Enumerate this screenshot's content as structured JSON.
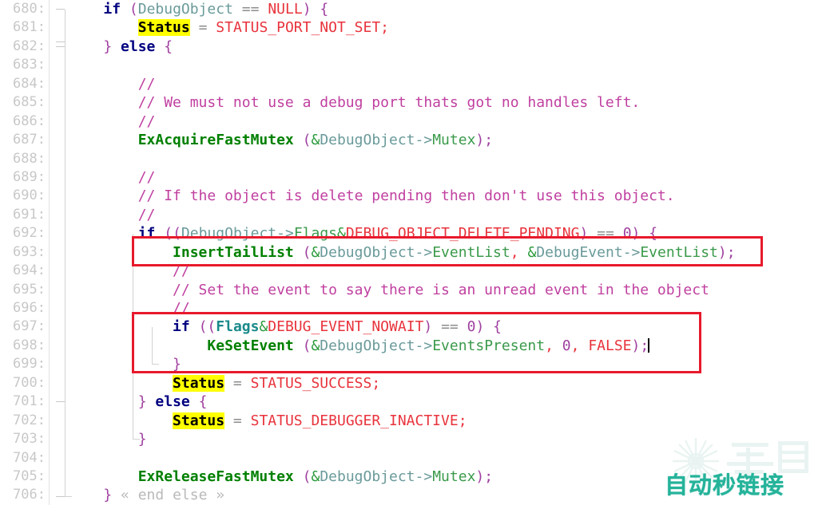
{
  "editor": {
    "language": "c",
    "gutter_separator_color": "#e3e3e3",
    "background": "#ffffff",
    "search_highlight_color": "#ffff00",
    "annotation_color": "#e8192c",
    "first_line_number": 680,
    "last_line_number": 706
  },
  "line_numbers": [
    "680:",
    "681:",
    "682:",
    "683:",
    "684:",
    "685:",
    "686:",
    "687:",
    "688:",
    "689:",
    "690:",
    "691:",
    "692:",
    "693:",
    "694:",
    "695:",
    "696:",
    "697:",
    "698:",
    "699:",
    "700:",
    "701:",
    "702:",
    "703:",
    "704:",
    "705:",
    "706:"
  ],
  "lines": {
    "l680": {
      "n": "680",
      "text": "    if (DebugObject == NULL) {"
    },
    "l681": {
      "n": "681",
      "text": "        Status = STATUS_PORT_NOT_SET;"
    },
    "l682": {
      "n": "682",
      "text": "    } else {"
    },
    "l683": {
      "n": "683",
      "text": ""
    },
    "l684": {
      "n": "684",
      "text": "        //"
    },
    "l685": {
      "n": "685",
      "text": "        // We must not use a debug port thats got no handles left."
    },
    "l686": {
      "n": "686",
      "text": "        //"
    },
    "l687": {
      "n": "687",
      "text": "        ExAcquireFastMutex (&DebugObject->Mutex);"
    },
    "l688": {
      "n": "688",
      "text": ""
    },
    "l689": {
      "n": "689",
      "text": "        //"
    },
    "l690": {
      "n": "690",
      "text": "        // If the object is delete pending then don't use this object."
    },
    "l691": {
      "n": "691",
      "text": "        //"
    },
    "l692": {
      "n": "692",
      "text": "        if ((DebugObject->Flags&DEBUG_OBJECT_DELETE_PENDING) == 0) {"
    },
    "l693": {
      "n": "693",
      "text": "            InsertTailList (&DebugObject->EventList, &DebugEvent->EventList);"
    },
    "l694": {
      "n": "694",
      "text": "            //"
    },
    "l695": {
      "n": "695",
      "text": "            // Set the event to say there is an unread event in the object"
    },
    "l696": {
      "n": "696",
      "text": "            //"
    },
    "l697": {
      "n": "697",
      "text": "            if ((Flags&DEBUG_EVENT_NOWAIT) == 0) {"
    },
    "l698": {
      "n": "698",
      "text": "                KeSetEvent (&DebugObject->EventsPresent, 0, FALSE);"
    },
    "l699": {
      "n": "699",
      "text": "            }"
    },
    "l700": {
      "n": "700",
      "text": "            Status = STATUS_SUCCESS;"
    },
    "l701": {
      "n": "701",
      "text": "        } else {"
    },
    "l702": {
      "n": "702",
      "text": "            Status = STATUS_DEBUGGER_INACTIVE;"
    },
    "l703": {
      "n": "703",
      "text": "        }"
    },
    "l704": {
      "n": "704",
      "text": ""
    },
    "l705": {
      "n": "705",
      "text": "        ExReleaseFastMutex (&DebugObject->Mutex);"
    },
    "l706": {
      "n": "706",
      "text": "    } « end else »"
    }
  },
  "tokens": {
    "kw_if": "if",
    "kw_else": "else",
    "paren_open": "(",
    "paren_close": ")",
    "brace_open": "{",
    "brace_close": "}",
    "semicolon": ";",
    "comma": ",",
    "assign": "=",
    "equals": "==",
    "ampersand": "&",
    "address_of": "&",
    "arrow": "->",
    "comment_slashes": "//",
    "zero": "0",
    "var_debugobject": "DebugObject",
    "var_debugevent": "DebugEvent",
    "var_status": "Status",
    "var_flags": "Flags",
    "mem_mutex": "Mutex",
    "mem_flags": "Flags",
    "mem_eventlist": "EventList",
    "mem_eventspresent": "EventsPresent",
    "macro_null": "NULL",
    "macro_false": "FALSE",
    "macro_status_port_not_set": "STATUS_PORT_NOT_SET",
    "macro_status_success": "STATUS_SUCCESS",
    "macro_status_debugger_inactive": "STATUS_DEBUGGER_INACTIVE",
    "macro_debug_object_delete_pending": "DEBUG_OBJECT_DELETE_PENDING",
    "macro_debug_event_nowait": "DEBUG_EVENT_NOWAIT",
    "fn_exacquirefastmutex": "ExAcquireFastMutex",
    "fn_exreleasefastmutex": "ExReleaseFastMutex",
    "fn_inserttaillist": "InsertTailList",
    "fn_kesetevent": "KeSetEvent",
    "cmt_684": "//",
    "cmt_685": "// We must not use a debug port thats got no handles left.",
    "cmt_686": "//",
    "cmt_689": "//",
    "cmt_690": "// If the object is delete pending then don't use this object.",
    "cmt_691": "//",
    "cmt_694": "//",
    "cmt_695": "// Set the event to say there is an unread event in the object",
    "cmt_696": "//",
    "fold_end_else": "« end else »"
  },
  "annotations": [
    {
      "id": "box-insert-tail-list",
      "label": "InsertTailList highlight box"
    },
    {
      "id": "box-kesetevent-if",
      "label": "DEBUG_EVENT_NOWAIT block highlight box"
    }
  ],
  "watermark": {
    "text": "自动秒链接",
    "logo_text": "看雪",
    "color": "#25b39a"
  }
}
